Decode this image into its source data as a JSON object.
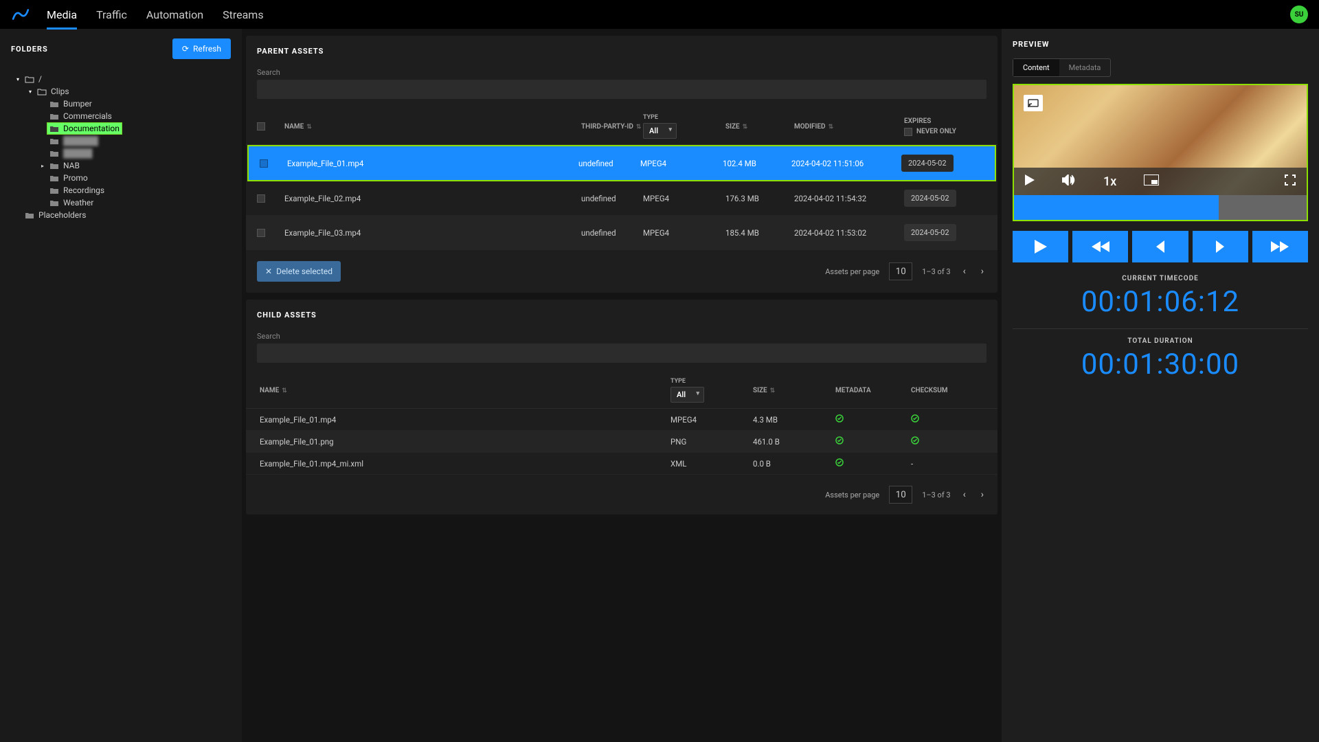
{
  "nav": {
    "items": [
      "Media",
      "Traffic",
      "Automation",
      "Streams"
    ],
    "active": "Media"
  },
  "avatar": "SU",
  "sidebar": {
    "title": "FOLDERS",
    "refresh": "Refresh",
    "root": "/",
    "tree": {
      "clips": "Clips",
      "children": [
        "Bumper",
        "Commercials",
        "Documentation",
        "",
        "",
        "NAB",
        "Promo",
        "Recordings",
        "Weather"
      ],
      "selected": "Documentation",
      "placeholders": "Placeholders"
    }
  },
  "parent": {
    "title": "PARENT ASSETS",
    "search_label": "Search",
    "cols": {
      "name": "NAME",
      "tpid": "THIRD-PARTY-ID",
      "type": "TYPE",
      "size": "SIZE",
      "modified": "MODIFIED",
      "expires": "EXPIRES",
      "never": "NEVER ONLY"
    },
    "type_all": "All",
    "rows": [
      {
        "name": "Example_File_01.mp4",
        "tpid": "undefined",
        "type": "MPEG4",
        "size": "102.4 MB",
        "modified": "2024-04-02 11:51:06",
        "expires": "2024-05-02",
        "selected": true
      },
      {
        "name": "Example_File_02.mp4",
        "tpid": "undefined",
        "type": "MPEG4",
        "size": "176.3 MB",
        "modified": "2024-04-02 11:54:32",
        "expires": "2024-05-02",
        "selected": false
      },
      {
        "name": "Example_File_03.mp4",
        "tpid": "undefined",
        "type": "MPEG4",
        "size": "185.4 MB",
        "modified": "2024-04-02 11:53:02",
        "expires": "2024-05-02",
        "selected": false
      }
    ],
    "delete": "Delete selected",
    "per_page_label": "Assets per page",
    "per_page": "10",
    "range": "1–3 of 3"
  },
  "child": {
    "title": "CHILD ASSETS",
    "search_label": "Search",
    "cols": {
      "name": "NAME",
      "type": "TYPE",
      "size": "SIZE",
      "metadata": "METADATA",
      "checksum": "CHECKSUM"
    },
    "type_all": "All",
    "rows": [
      {
        "name": "Example_File_01.mp4",
        "type": "MPEG4",
        "size": "4.3 MB",
        "metadata": true,
        "checksum": true
      },
      {
        "name": "Example_File_01.png",
        "type": "PNG",
        "size": "461.0 B",
        "metadata": true,
        "checksum": true
      },
      {
        "name": "Example_File_01.mp4_mi.xml",
        "type": "XML",
        "size": "0.0 B",
        "metadata": true,
        "checksum": false
      }
    ],
    "per_page_label": "Assets per page",
    "per_page": "10",
    "range": "1–3 of 3"
  },
  "preview": {
    "title": "PREVIEW",
    "tabs": [
      "Content",
      "Metadata"
    ],
    "active_tab": "Content",
    "speed": "1x",
    "current_label": "CURRENT TIMECODE",
    "current": "00:01:06:12",
    "duration_label": "TOTAL DURATION",
    "duration": "00:01:30:00"
  }
}
